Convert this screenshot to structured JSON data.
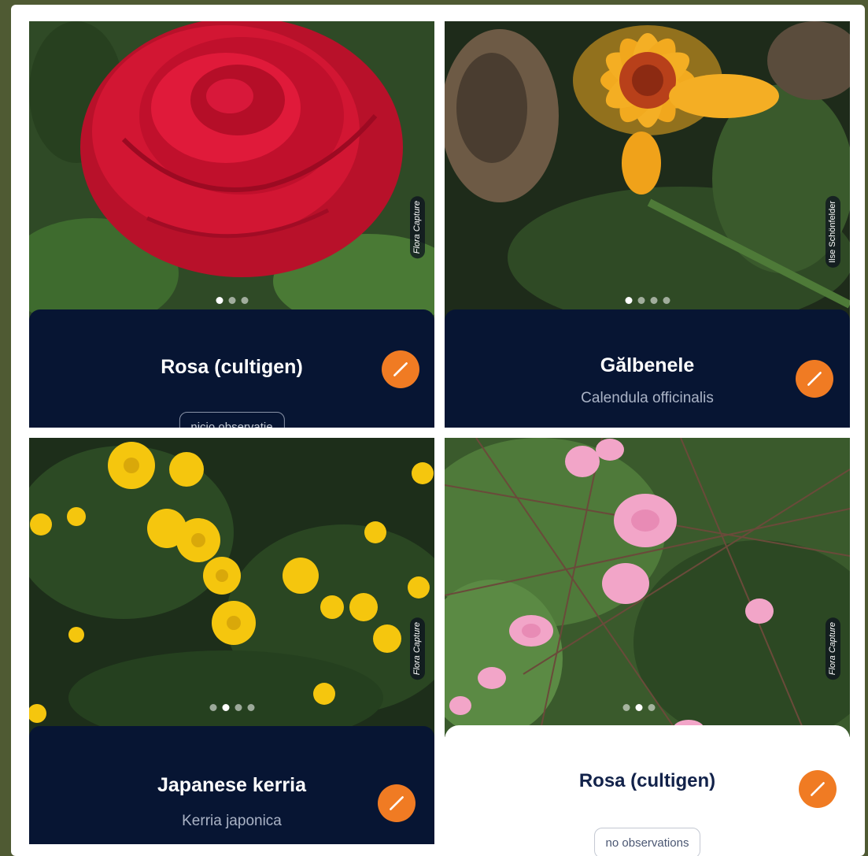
{
  "colors": {
    "accent": "#f07b23",
    "panel_dark": "#071533",
    "background": "#4f5a33"
  },
  "cards": [
    {
      "common_name": "Rosa (cultigen)",
      "scientific_name": "",
      "credit": "Flora Capture",
      "observations_label": "niciо observatie",
      "dots": 3,
      "active_dot": 0,
      "edit_icon": "pencil-icon"
    },
    {
      "common_name": "Gălbenele",
      "scientific_name": "Calendula officinalis",
      "credit": "Ilse Schönfelder",
      "observations_label": "",
      "dots": 4,
      "active_dot": 0,
      "edit_icon": "pencil-icon"
    },
    {
      "common_name": "Japanese kerria",
      "scientific_name": "Kerria japonica",
      "credit": "Flora Capture",
      "observations_label": "",
      "dots": 4,
      "active_dot": 1,
      "edit_icon": "pencil-icon"
    },
    {
      "common_name": "Rosa (cultigen)",
      "scientific_name": "",
      "credit": "Flora Capture",
      "observations_label": "no observations",
      "dots": 3,
      "active_dot": 1,
      "edit_icon": "pencil-icon"
    }
  ]
}
